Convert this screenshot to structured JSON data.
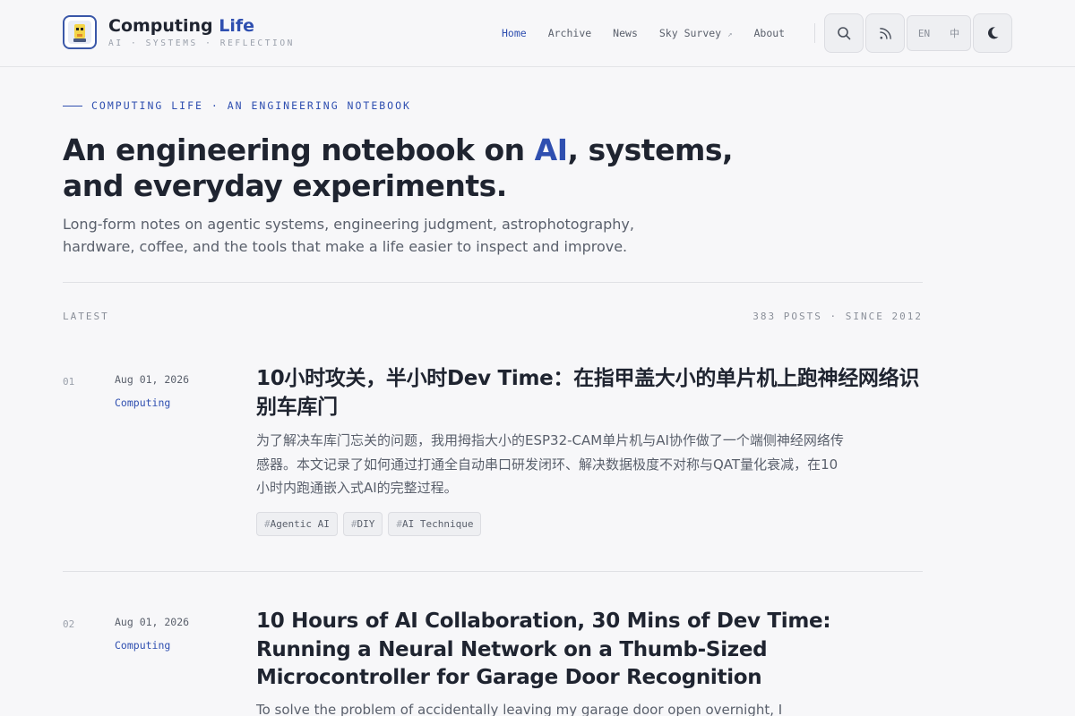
{
  "brand": {
    "title_main": "Computing",
    "title_accent": "Life",
    "subtitle": "AI · SYSTEMS · REFLECTION"
  },
  "nav": {
    "items": [
      {
        "label": "Home",
        "active": true
      },
      {
        "label": "Archive"
      },
      {
        "label": "News"
      },
      {
        "label": "Sky Survey",
        "external_marker": "↗"
      },
      {
        "label": "About"
      }
    ]
  },
  "header_controls": {
    "search_icon": "search-icon",
    "rss_icon": "rss-icon",
    "lang_en": "EN",
    "lang_zh": "中",
    "theme_icon": "moon-icon"
  },
  "hero": {
    "eyebrow": "COMPUTING LIFE · AN ENGINEERING NOTEBOOK",
    "title_before": "An engineering notebook on ",
    "title_accent": "AI",
    "title_after": ", systems, and everyday experiments.",
    "description": "Long-form notes on agentic systems, engineering judgment, astrophotography, hardware, coffee, and the tools that make a life easier to inspect and improve."
  },
  "listing": {
    "label": "LATEST",
    "count_text": "383 POSTS · SINCE 2012"
  },
  "posts": [
    {
      "number": "01",
      "date": "Aug 01, 2026",
      "category": "Computing",
      "title": "10小时攻关，半小时Dev Time：在指甲盖大小的单片机上跑神经网络识别车库门",
      "excerpt": "为了解决车库门忘关的问题，我用拇指大小的ESP32-CAM单片机与AI协作做了一个端侧神经网络传感器。本文记录了如何通过打通全自动串口研发闭环、解决数据极度不对称与QAT量化衰减，在10小时内跑通嵌入式AI的完整过程。",
      "tags": [
        "Agentic AI",
        "DIY",
        "AI Technique"
      ]
    },
    {
      "number": "02",
      "date": "Aug 01, 2026",
      "category": "Computing",
      "title": "10 Hours of AI Collaboration, 30 Mins of Dev Time: Running a Neural Network on a Thumb-Sized Microcontroller for Garage Door Recognition",
      "excerpt": "To solve the problem of accidentally leaving my garage door open overnight, I"
    }
  ],
  "colors": {
    "accent": "#2f4fb0",
    "background": "#f7f7f9",
    "text": "#1f2430",
    "muted": "#5a606c"
  }
}
